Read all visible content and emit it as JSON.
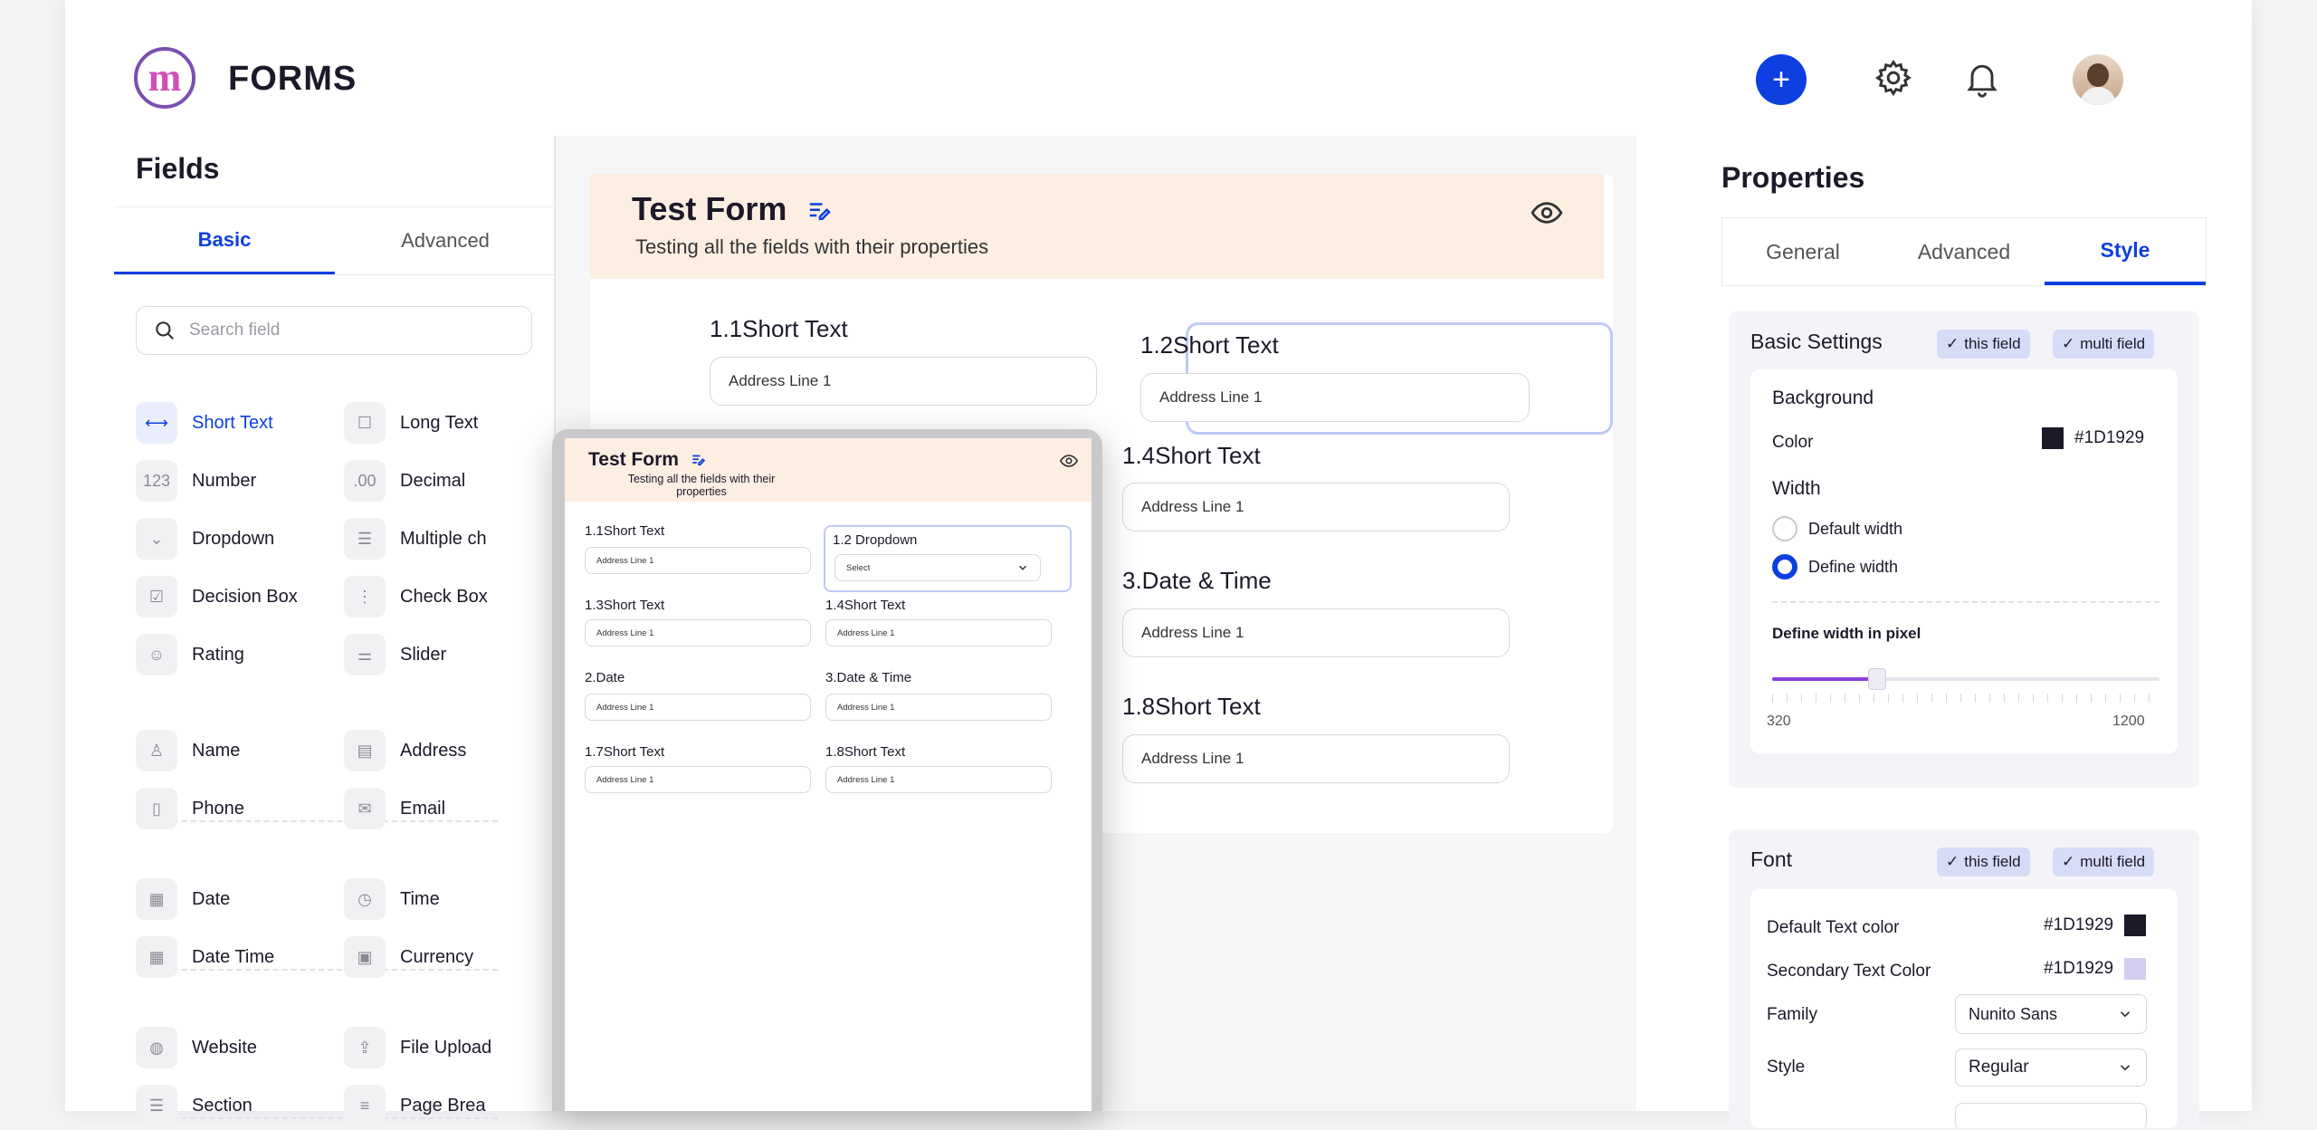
{
  "app": {
    "title": "FORMS"
  },
  "header": {
    "add_icon": "plus",
    "settings_icon": "gear-icon",
    "notifications_icon": "bell-icon",
    "avatar": "user-avatar"
  },
  "fields_panel": {
    "title": "Fields",
    "tabs": [
      {
        "label": "Basic",
        "active": true
      },
      {
        "label": "Advanced",
        "active": false
      }
    ],
    "search_placeholder": "Search field",
    "groups": [
      [
        {
          "label": "Short Text",
          "icon": "short-text-icon",
          "glyph": "⟷",
          "active": true
        },
        {
          "label": "Long Text",
          "icon": "long-text-icon",
          "glyph": "☐"
        },
        {
          "label": "Number",
          "icon": "number-icon",
          "glyph": "123"
        },
        {
          "label": "Decimal",
          "icon": "decimal-icon",
          "glyph": ".00"
        },
        {
          "label": "Dropdown",
          "icon": "dropdown-icon",
          "glyph": "⌄"
        },
        {
          "label": "Multiple ch",
          "icon": "multiple-choice-icon",
          "glyph": "☰"
        },
        {
          "label": "Decision Box",
          "icon": "decision-box-icon",
          "glyph": "☑"
        },
        {
          "label": "Check Box",
          "icon": "check-box-icon",
          "glyph": "⋮"
        },
        {
          "label": "Rating",
          "icon": "rating-icon",
          "glyph": "☺"
        },
        {
          "label": "Slider",
          "icon": "slider-icon",
          "glyph": "⚌"
        }
      ],
      [
        {
          "label": "Name",
          "icon": "name-icon",
          "glyph": "♙"
        },
        {
          "label": "Address",
          "icon": "address-icon",
          "glyph": "▤"
        },
        {
          "label": "Phone",
          "icon": "phone-icon",
          "glyph": "▯"
        },
        {
          "label": "Email",
          "icon": "email-icon",
          "glyph": "✉"
        }
      ],
      [
        {
          "label": "Date",
          "icon": "date-icon",
          "glyph": "▦"
        },
        {
          "label": "Time",
          "icon": "time-icon",
          "glyph": "◷"
        },
        {
          "label": "Date Time",
          "icon": "date-time-icon",
          "glyph": "▦"
        },
        {
          "label": "Currency",
          "icon": "currency-icon",
          "glyph": "▣"
        }
      ],
      [
        {
          "label": "Website",
          "icon": "website-icon",
          "glyph": "◍"
        },
        {
          "label": "File Upload",
          "icon": "file-upload-icon",
          "glyph": "⇪"
        },
        {
          "label": "Section",
          "icon": "section-icon",
          "glyph": "☰"
        },
        {
          "label": "Page Brea",
          "icon": "page-break-icon",
          "glyph": "≡"
        }
      ]
    ]
  },
  "form": {
    "title": "Test Form",
    "subtitle": "Testing all the fields with their properties",
    "fields": [
      {
        "label": "1.1Short Text",
        "value": "Address Line 1"
      },
      {
        "label": "1.2Short Text",
        "value": "Address Line 1"
      },
      {
        "label": "1.4Short Text",
        "value": "Address Line 1"
      },
      {
        "label": "3.Date & Time",
        "value": "Address Line 1"
      },
      {
        "label": "1.8Short Text",
        "value": "Address Line 1"
      }
    ],
    "hidden_inputs": [
      "",
      "",
      ""
    ]
  },
  "preview": {
    "title": "Test Form",
    "subtitle": "Testing all the fields with their properties",
    "fields": [
      {
        "label": "1.1Short Text",
        "value": "Address Line 1"
      },
      {
        "label": "1.2 Dropdown",
        "value": "Select"
      },
      {
        "label": "1.3Short Text",
        "value": "Address Line 1"
      },
      {
        "label": "1.4Short Text",
        "value": "Address Line 1"
      },
      {
        "label": "2.Date",
        "value": "Address Line 1"
      },
      {
        "label": "3.Date & Time",
        "value": "Address Line 1"
      },
      {
        "label": "1.7Short Text",
        "value": "Address Line 1"
      },
      {
        "label": "1.8Short Text",
        "value": "Address Line 1"
      }
    ]
  },
  "properties": {
    "title": "Properties",
    "tabs": [
      {
        "label": "General"
      },
      {
        "label": "Advanced"
      },
      {
        "label": "Style",
        "active": true
      }
    ],
    "basic_settings": {
      "title": "Basic Settings",
      "chip_this": "this field",
      "chip_multi": "multi field",
      "background_label": "Background",
      "color_label": "Color",
      "color_value": "#1D1929",
      "width_label": "Width",
      "width_options": [
        {
          "label": "Default width",
          "selected": false
        },
        {
          "label": "Define width",
          "selected": true
        }
      ],
      "pixel_label": "Define width in pixel",
      "slider_min": "320",
      "slider_max": "1200",
      "slider_fraction": 0.27
    },
    "font": {
      "title": "Font",
      "chip_this": "this field",
      "chip_multi": "multi field",
      "default_color_label": "Default Text color",
      "default_color_value": "#1D1929",
      "default_color_swatch": "#1D1929",
      "secondary_color_label": "Secondary Text Color",
      "secondary_color_value": "#1D1929",
      "secondary_color_swatch": "#d4cff0",
      "family_label": "Family",
      "family_value": "Nunito Sans",
      "style_label": "Style",
      "style_value": "Regular"
    }
  },
  "colors": {
    "accent": "#0d3fe0",
    "header_bg": "#fdeee2",
    "text": "#1D1929",
    "slider": "#8a3fe0"
  }
}
